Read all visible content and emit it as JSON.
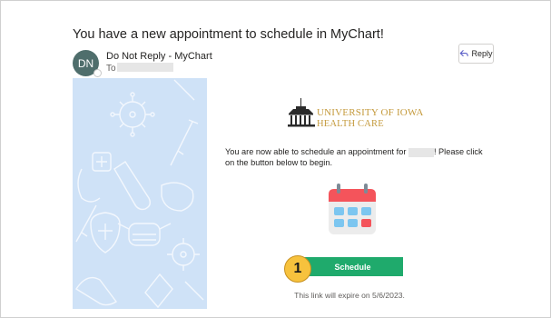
{
  "email": {
    "subject": "You have a new appointment to schedule in MyChart!",
    "avatar_initials": "DN",
    "sender": "Do Not Reply - MyChart",
    "to_label": "To",
    "reply_label": "Reply"
  },
  "logo": {
    "line1": "UNIVERSITY OF IOWA",
    "line2": "HEALTH CARE"
  },
  "message": {
    "text_before": "You are now able to schedule an appointment for ",
    "text_after": "! Please click on the button below to begin."
  },
  "cta": {
    "badge_number": "1",
    "schedule_label": "Schedule",
    "expire_text": "This link will expire on 5/6/2023."
  },
  "colors": {
    "hero_bg": "#cfe2f7",
    "button_green": "#1faa6c",
    "badge_yellow": "#f7c23d",
    "logo_gold": "#c49a3c"
  }
}
